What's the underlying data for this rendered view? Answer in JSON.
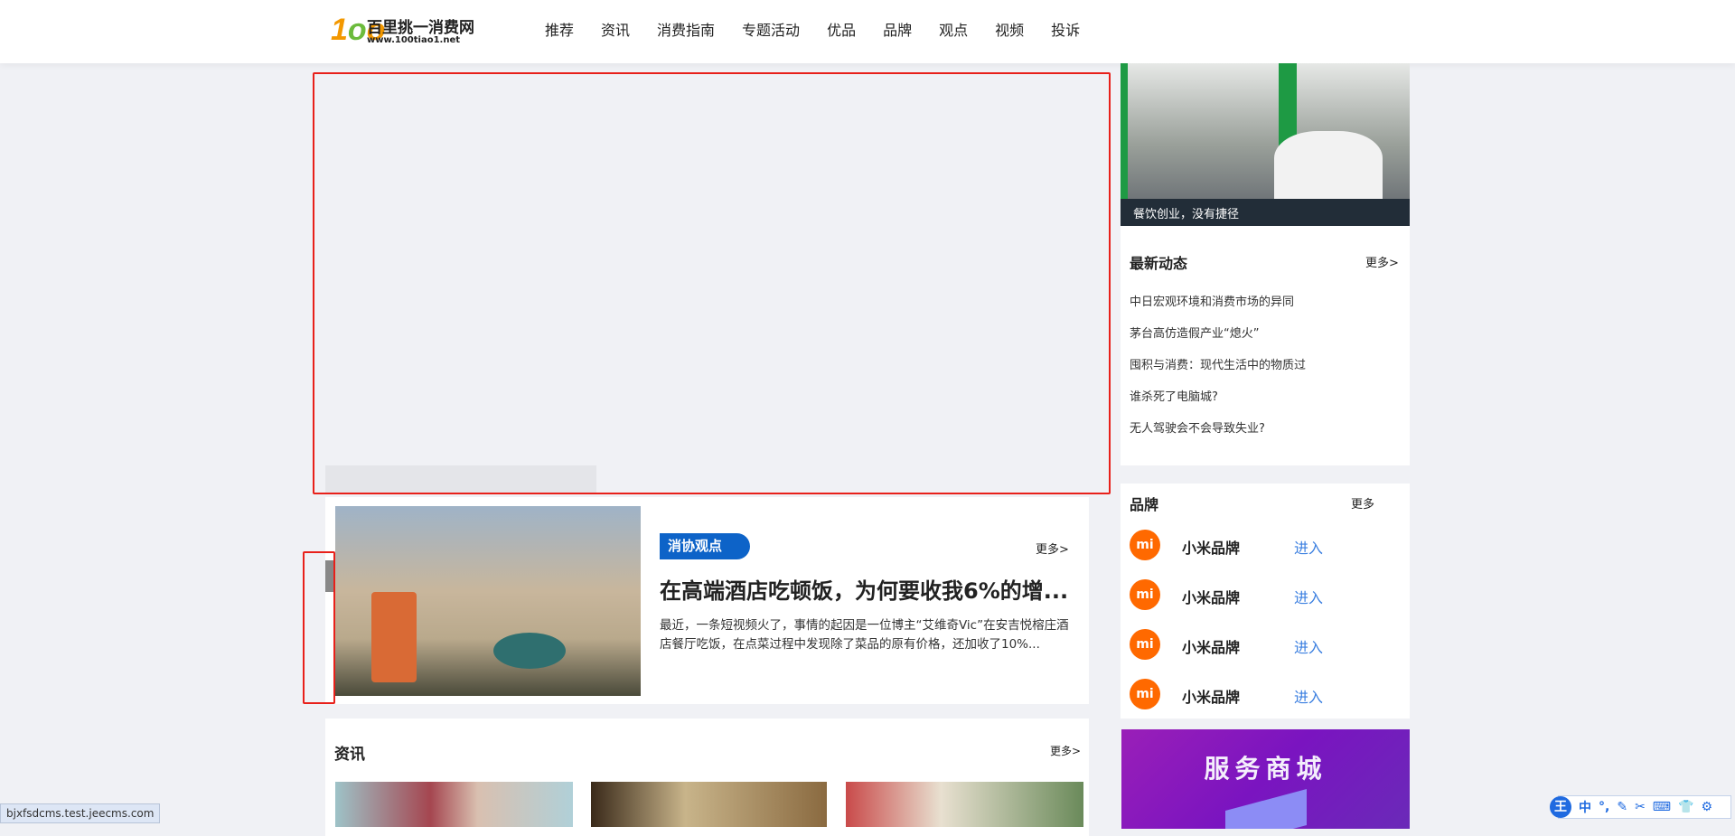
{
  "logo": {
    "name": "百里挑一消费网",
    "url": "www.100tiao1.net"
  },
  "nav": [
    "推荐",
    "资讯",
    "消费指南",
    "专题活动",
    "优品",
    "品牌",
    "观点",
    "视频",
    "投诉"
  ],
  "feature": {
    "tag": "消协观点",
    "more": "更多>",
    "title": "在高端酒店吃顿饭，为何要收我6%的增...",
    "summary": "最近，一条短视频火了，事情的起因是一位博主“艾维奇Vic”在安吉悦榕庄酒店餐厅吃饭，在点菜过程中发现除了菜品的原有价格，还加收了10%..."
  },
  "news_section": {
    "title": "资讯",
    "more": "更多>"
  },
  "side_banner": {
    "caption": "餐饮创业，没有捷径"
  },
  "latest": {
    "title": "最新动态",
    "more": "更多>",
    "items": [
      "中日宏观环境和消费市场的异同",
      "茅台高仿造假产业“熄火”",
      "囤积与消费：现代生活中的物质过",
      "谁杀死了电脑城?",
      "无人驾驶会不会导致失业?"
    ]
  },
  "brands": {
    "title": "品牌",
    "more": "更多",
    "items": [
      {
        "logo": "mi",
        "name": "小米品牌",
        "enter": "进入"
      },
      {
        "logo": "mi",
        "name": "小米品牌",
        "enter": "进入"
      },
      {
        "logo": "mi",
        "name": "小米品牌",
        "enter": "进入"
      },
      {
        "logo": "mi",
        "name": "小米品牌",
        "enter": "进入"
      }
    ]
  },
  "promo": {
    "title": "服务商城"
  },
  "statusbar": "bjxfsdcms.test.jeecms.com",
  "ime": {
    "logo": "王",
    "items": [
      "中",
      "°,",
      "✎",
      "✂",
      "⌨",
      "👕",
      "⚙"
    ]
  },
  "colors": {
    "accent": "#0d63c8",
    "brand_orange": "#ff6900",
    "link_blue": "#3b7fe0",
    "highlight": "#e8201a"
  }
}
